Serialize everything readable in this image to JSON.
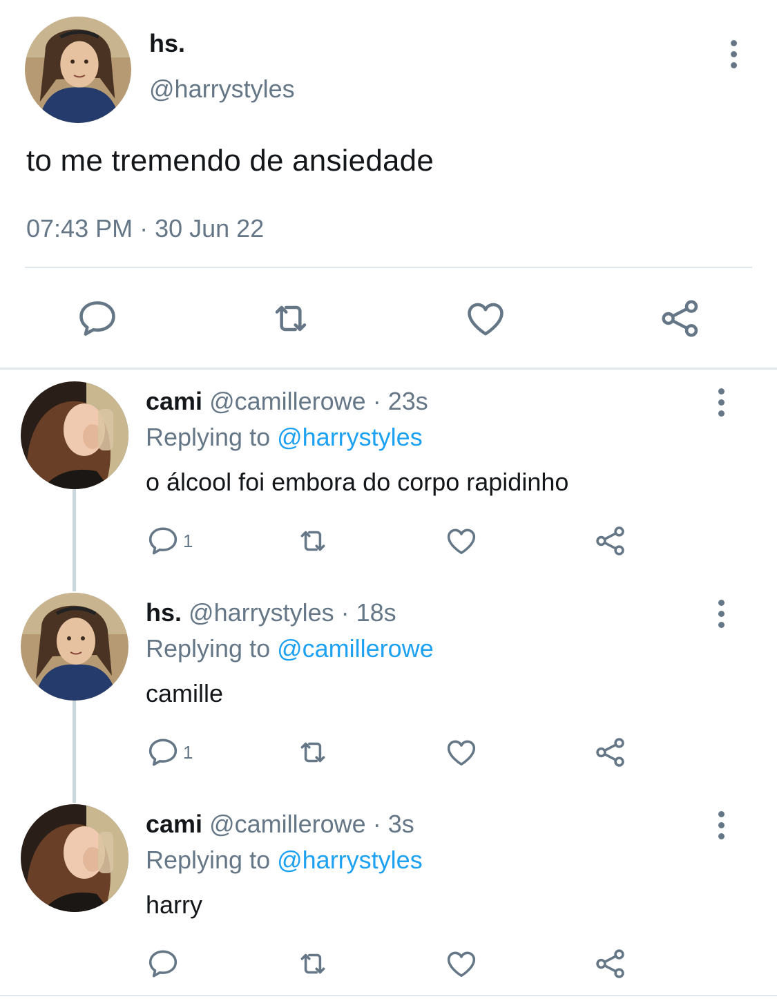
{
  "main_tweet": {
    "display_name": "hs.",
    "handle": "@harrystyles",
    "text": "to me tremendo de ansiedade",
    "timestamp": "07:43 PM · 30 Jun 22",
    "actions": [
      "reply-icon",
      "retweet-icon",
      "like-icon",
      "share-icon"
    ]
  },
  "replies": [
    {
      "display_name": "cami",
      "handle": "@camillerowe",
      "time": "· 23s",
      "replying_prefix": "Replying to ",
      "replying_to": "@harrystyles",
      "text": "o álcool foi embora do corpo rapidinho",
      "reply_count": "1"
    },
    {
      "display_name": "hs.",
      "handle": "@harrystyles",
      "time": "· 18s",
      "replying_prefix": "Replying to ",
      "replying_to": "@camillerowe",
      "text": "camille",
      "reply_count": "1"
    },
    {
      "display_name": "cami",
      "handle": "@camillerowe",
      "time": "· 3s",
      "replying_prefix": "Replying to ",
      "replying_to": "@harrystyles",
      "text": "harry",
      "reply_count": ""
    }
  ],
  "colors": {
    "text": "#14171a",
    "muted": "#657786",
    "link": "#1da1f2",
    "divider": "#e1e8ed",
    "thread_line": "#ccd6dd"
  }
}
